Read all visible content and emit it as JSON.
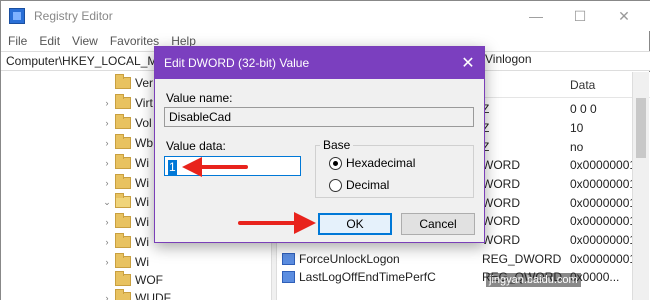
{
  "window": {
    "title": "Registry Editor",
    "controls": {
      "minimize": "—",
      "maximize": "☐",
      "close": "✕"
    }
  },
  "menu": [
    "File",
    "Edit",
    "View",
    "Favorites",
    "Help"
  ],
  "address": {
    "path": "Computer\\HKEY_LOCAL_MA",
    "tail": "Vinlogon"
  },
  "tree": {
    "items": [
      {
        "label": "Ver",
        "expandable": false
      },
      {
        "label": "Virt",
        "expandable": true
      },
      {
        "label": "Vol",
        "expandable": true
      },
      {
        "label": "Wb",
        "expandable": true
      },
      {
        "label": "Wi",
        "expandable": true
      },
      {
        "label": "Wi",
        "expandable": true
      },
      {
        "label": "Wi",
        "expandable": true,
        "selected": true
      },
      {
        "label": "Wi",
        "expandable": true
      },
      {
        "label": "Wi",
        "expandable": true
      },
      {
        "label": "Wi",
        "expandable": true
      },
      {
        "label": "WOF",
        "expandable": false
      },
      {
        "label": "WUDF",
        "expandable": true
      }
    ]
  },
  "list": {
    "column_data": "Data",
    "rows": [
      {
        "type": "Z",
        "data": "0 0 0"
      },
      {
        "type": "Z",
        "data": "10"
      },
      {
        "type": "Z",
        "data": "no"
      },
      {
        "type": "WORD",
        "data": "0x00000001"
      },
      {
        "type": "WORD",
        "data": "0x00000001"
      },
      {
        "type": "WORD",
        "data": "0x00000001"
      },
      {
        "type": "WORD",
        "data": "0x00000001"
      },
      {
        "type": "WORD",
        "data": "0x00000001"
      },
      {
        "name": "ForceUnlockLogon",
        "type": "REG_DWORD",
        "data": "0x00000001"
      },
      {
        "name": "LastLogOffEndTimePerfC",
        "type": "REG_QWORD",
        "data": "0x0000..."
      }
    ]
  },
  "watermark": "jingyan.baidu.com",
  "dialog": {
    "title": "Edit DWORD (32-bit) Value",
    "close": "✕",
    "value_name_label": "Value name:",
    "value_name": "DisableCad",
    "value_data_label": "Value data:",
    "value_data": "1",
    "base_label": "Base",
    "base_options": [
      {
        "label": "Hexadecimal",
        "selected": true
      },
      {
        "label": "Decimal",
        "selected": false
      }
    ],
    "ok_label": "OK",
    "cancel_label": "Cancel"
  },
  "colors": {
    "dialog_titlebar": "#7b3fbf",
    "accent": "#0078d7",
    "annotation_arrow": "#e8231c"
  }
}
